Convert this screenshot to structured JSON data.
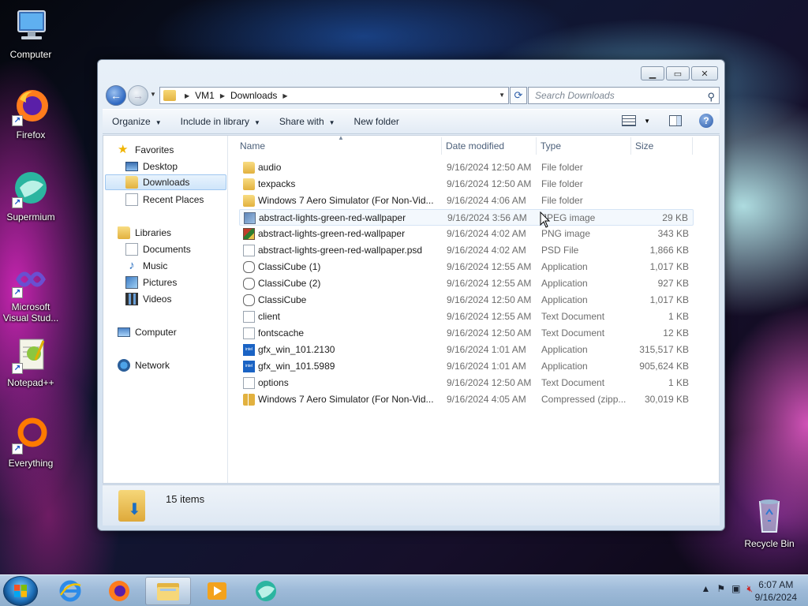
{
  "desktop": {
    "icons": [
      {
        "label": "Computer"
      },
      {
        "label": "Firefox"
      },
      {
        "label": "Supermium"
      },
      {
        "label": "Microsoft Visual Stud..."
      },
      {
        "label": "Notepad++"
      },
      {
        "label": "Everything"
      },
      {
        "label": "Recycle Bin"
      }
    ]
  },
  "window": {
    "breadcrumb": [
      "VM1",
      "Downloads"
    ],
    "search_placeholder": "Search Downloads",
    "toolbar": {
      "organize": "Organize",
      "include_in_library": "Include in library",
      "share_with": "Share with",
      "new_folder": "New folder"
    },
    "nav": {
      "favorites": "Favorites",
      "desktop": "Desktop",
      "downloads": "Downloads",
      "recent_places": "Recent Places",
      "libraries": "Libraries",
      "documents": "Documents",
      "music": "Music",
      "pictures": "Pictures",
      "videos": "Videos",
      "computer": "Computer",
      "network": "Network"
    },
    "columns": {
      "name": "Name",
      "date": "Date modified",
      "type": "Type",
      "size": "Size"
    },
    "files": [
      {
        "name": "audio",
        "date": "9/16/2024 12:50 AM",
        "type": "File folder",
        "size": "",
        "icon": "folder"
      },
      {
        "name": "texpacks",
        "date": "9/16/2024 12:50 AM",
        "type": "File folder",
        "size": "",
        "icon": "folder"
      },
      {
        "name": "Windows 7 Aero Simulator (For Non-Vid...",
        "date": "9/16/2024 4:06 AM",
        "type": "File folder",
        "size": "",
        "icon": "folder"
      },
      {
        "name": "abstract-lights-green-red-wallpaper",
        "date": "9/16/2024 3:56 AM",
        "type": "JPEG image",
        "size": "29 KB",
        "icon": "image"
      },
      {
        "name": "abstract-lights-green-red-wallpaper",
        "date": "9/16/2024 4:02 AM",
        "type": "PNG image",
        "size": "343 KB",
        "icon": "png"
      },
      {
        "name": "abstract-lights-green-red-wallpaper.psd",
        "date": "9/16/2024 4:02 AM",
        "type": "PSD File",
        "size": "1,866 KB",
        "icon": "doc"
      },
      {
        "name": "ClassiCube (1)",
        "date": "9/16/2024 12:55 AM",
        "type": "Application",
        "size": "1,017 KB",
        "icon": "app"
      },
      {
        "name": "ClassiCube (2)",
        "date": "9/16/2024 12:55 AM",
        "type": "Application",
        "size": "927 KB",
        "icon": "app"
      },
      {
        "name": "ClassiCube",
        "date": "9/16/2024 12:50 AM",
        "type": "Application",
        "size": "1,017 KB",
        "icon": "app"
      },
      {
        "name": "client",
        "date": "9/16/2024 12:55 AM",
        "type": "Text Document",
        "size": "1 KB",
        "icon": "doc"
      },
      {
        "name": "fontscache",
        "date": "9/16/2024 12:50 AM",
        "type": "Text Document",
        "size": "12 KB",
        "icon": "doc"
      },
      {
        "name": "gfx_win_101.2130",
        "date": "9/16/2024 1:01 AM",
        "type": "Application",
        "size": "315,517 KB",
        "icon": "intel"
      },
      {
        "name": "gfx_win_101.5989",
        "date": "9/16/2024 1:01 AM",
        "type": "Application",
        "size": "905,624 KB",
        "icon": "intel"
      },
      {
        "name": "options",
        "date": "9/16/2024 12:50 AM",
        "type": "Text Document",
        "size": "1 KB",
        "icon": "doc"
      },
      {
        "name": "Windows 7 Aero Simulator (For Non-Vid...",
        "date": "9/16/2024 4:05 AM",
        "type": "Compressed (zipp...",
        "size": "30,019 KB",
        "icon": "zipfolder"
      }
    ],
    "status": "15 items"
  },
  "taskbar": {
    "time": "6:07 AM",
    "date": "9/16/2024"
  }
}
